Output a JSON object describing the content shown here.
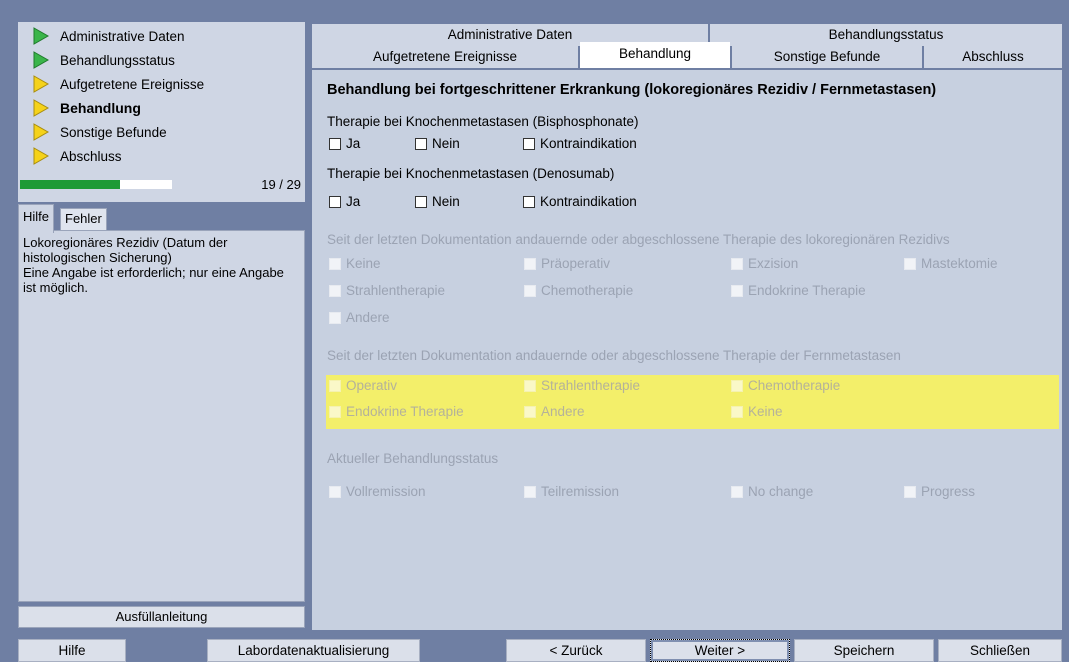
{
  "nav": {
    "items": [
      {
        "label": "Administrative Daten",
        "icon": "green-triangle-icon",
        "color": "#3ab54a"
      },
      {
        "label": "Behandlungsstatus",
        "icon": "green-triangle-icon",
        "color": "#3ab54a"
      },
      {
        "label": "Aufgetretene Ereignisse",
        "icon": "yellow-triangle-icon",
        "color": "#f5d21a"
      },
      {
        "label": "Behandlung",
        "icon": "yellow-triangle-icon",
        "color": "#f5d21a"
      },
      {
        "label": "Sonstige Befunde",
        "icon": "yellow-triangle-icon",
        "color": "#f5d21a"
      },
      {
        "label": "Abschluss",
        "icon": "yellow-triangle-icon",
        "color": "#f5d21a"
      }
    ],
    "active_index": 3
  },
  "progress": {
    "text": "19 / 29",
    "fraction": 0.655
  },
  "help_tabs": {
    "hilfe": "Hilfe",
    "fehler": "Fehler"
  },
  "help_text": "Lokoregionäres Rezidiv (Datum der histologischen Sicherung)\nEine Angabe ist erforderlich; nur eine Angabe ist möglich.",
  "anleitung_label": "Ausfüllanleitung",
  "tabs": {
    "row1": [
      "Administrative Daten",
      "Behandlungsstatus"
    ],
    "row2": [
      "Aufgetretene Ereignisse",
      "Behandlung",
      "Sonstige Befunde",
      "Abschluss"
    ],
    "active": "Behandlung"
  },
  "content": {
    "title": "Behandlung bei fortgeschrittener Erkrankung (lokoregionäres Rezidiv / Fernmetastasen)",
    "q1": {
      "label": "Therapie bei Knochenmetastasen (Bisphosphonate)",
      "options": [
        "Ja",
        "Nein",
        "Kontraindikation"
      ]
    },
    "q2": {
      "label": "Therapie bei Knochenmetastasen (Denosumab)",
      "options": [
        "Ja",
        "Nein",
        "Kontraindikation"
      ]
    },
    "q3": {
      "label": "Seit der letzten Dokumentation andauernde oder abgeschlossene Therapie des lokoregionären Rezidivs",
      "options": [
        "Keine",
        "Präoperativ",
        "Exzision",
        "Mastektomie",
        "Strahlentherapie",
        "Chemotherapie",
        "Endokrine Therapie",
        "Andere"
      ]
    },
    "q4": {
      "label": "Seit der letzten Dokumentation andauernde oder abgeschlossene Therapie der Fernmetastasen",
      "options": [
        "Operativ",
        "Strahlentherapie",
        "Chemotherapie",
        "Endokrine Therapie",
        "Andere",
        "Keine"
      ]
    },
    "q5": {
      "label": "Aktueller Behandlungsstatus",
      "options": [
        "Vollremission",
        "Teilremission",
        "No change",
        "Progress"
      ]
    }
  },
  "bottom": {
    "hilfe": "Hilfe",
    "labor": "Labordatenaktualisierung",
    "zurueck": "< Zurück",
    "weiter": "Weiter >",
    "speichern": "Speichern",
    "schliessen": "Schließen"
  },
  "colors": {
    "highlight": "#f3ef6a",
    "progress": "#1e9a36"
  }
}
